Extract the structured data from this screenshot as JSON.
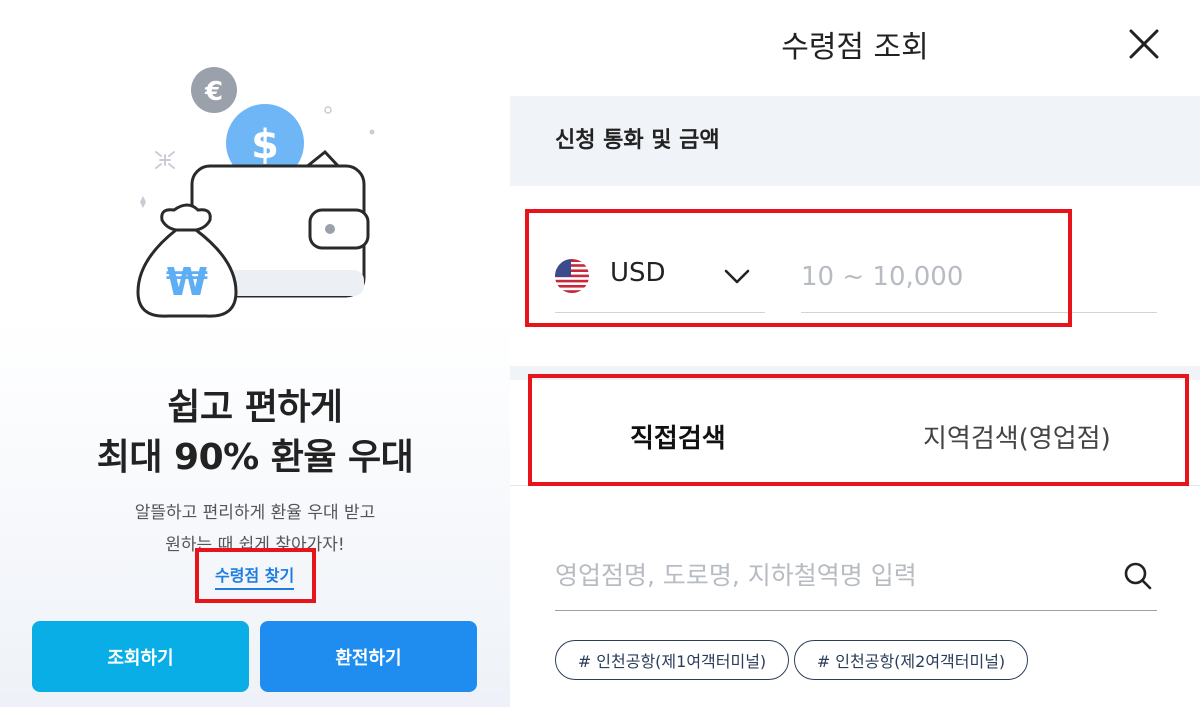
{
  "left": {
    "headline_line1": "쉽고 편하게",
    "headline_line2": "최대 90% 환율 우대",
    "desc_line1": "알뜰하고 편리하게 환율 우대 받고",
    "desc_line2": "원하는 때 쉽게 찾아가자!",
    "find_link": "수령점 찾기",
    "buttons": {
      "inquire": "조회하기",
      "exchange": "환전하기"
    },
    "illustration": {
      "euro_symbol": "€",
      "dollar_symbol": "$",
      "won_symbol": "₩"
    }
  },
  "right": {
    "title": "수령점 조회",
    "close_icon": "close-icon",
    "section_header": "신청 통화 및 금액",
    "currency": {
      "code": "USD",
      "flag": "us-flag-icon"
    },
    "amount_placeholder": "10 ~ 10,000",
    "tabs": [
      {
        "label": "직접검색",
        "active": true
      },
      {
        "label": "지역검색(영업점)",
        "active": false
      }
    ],
    "search_placeholder": "영업점명, 도로명, 지하철역명 입력",
    "tags": [
      "# 인천공항(제1여객터미널)",
      "# 인천공항(제2여객터미널)"
    ]
  },
  "colors": {
    "highlight": "#e8141c",
    "button_inquire": "#08aee5",
    "button_exchange": "#1f8df0",
    "link": "#1e7de0"
  }
}
